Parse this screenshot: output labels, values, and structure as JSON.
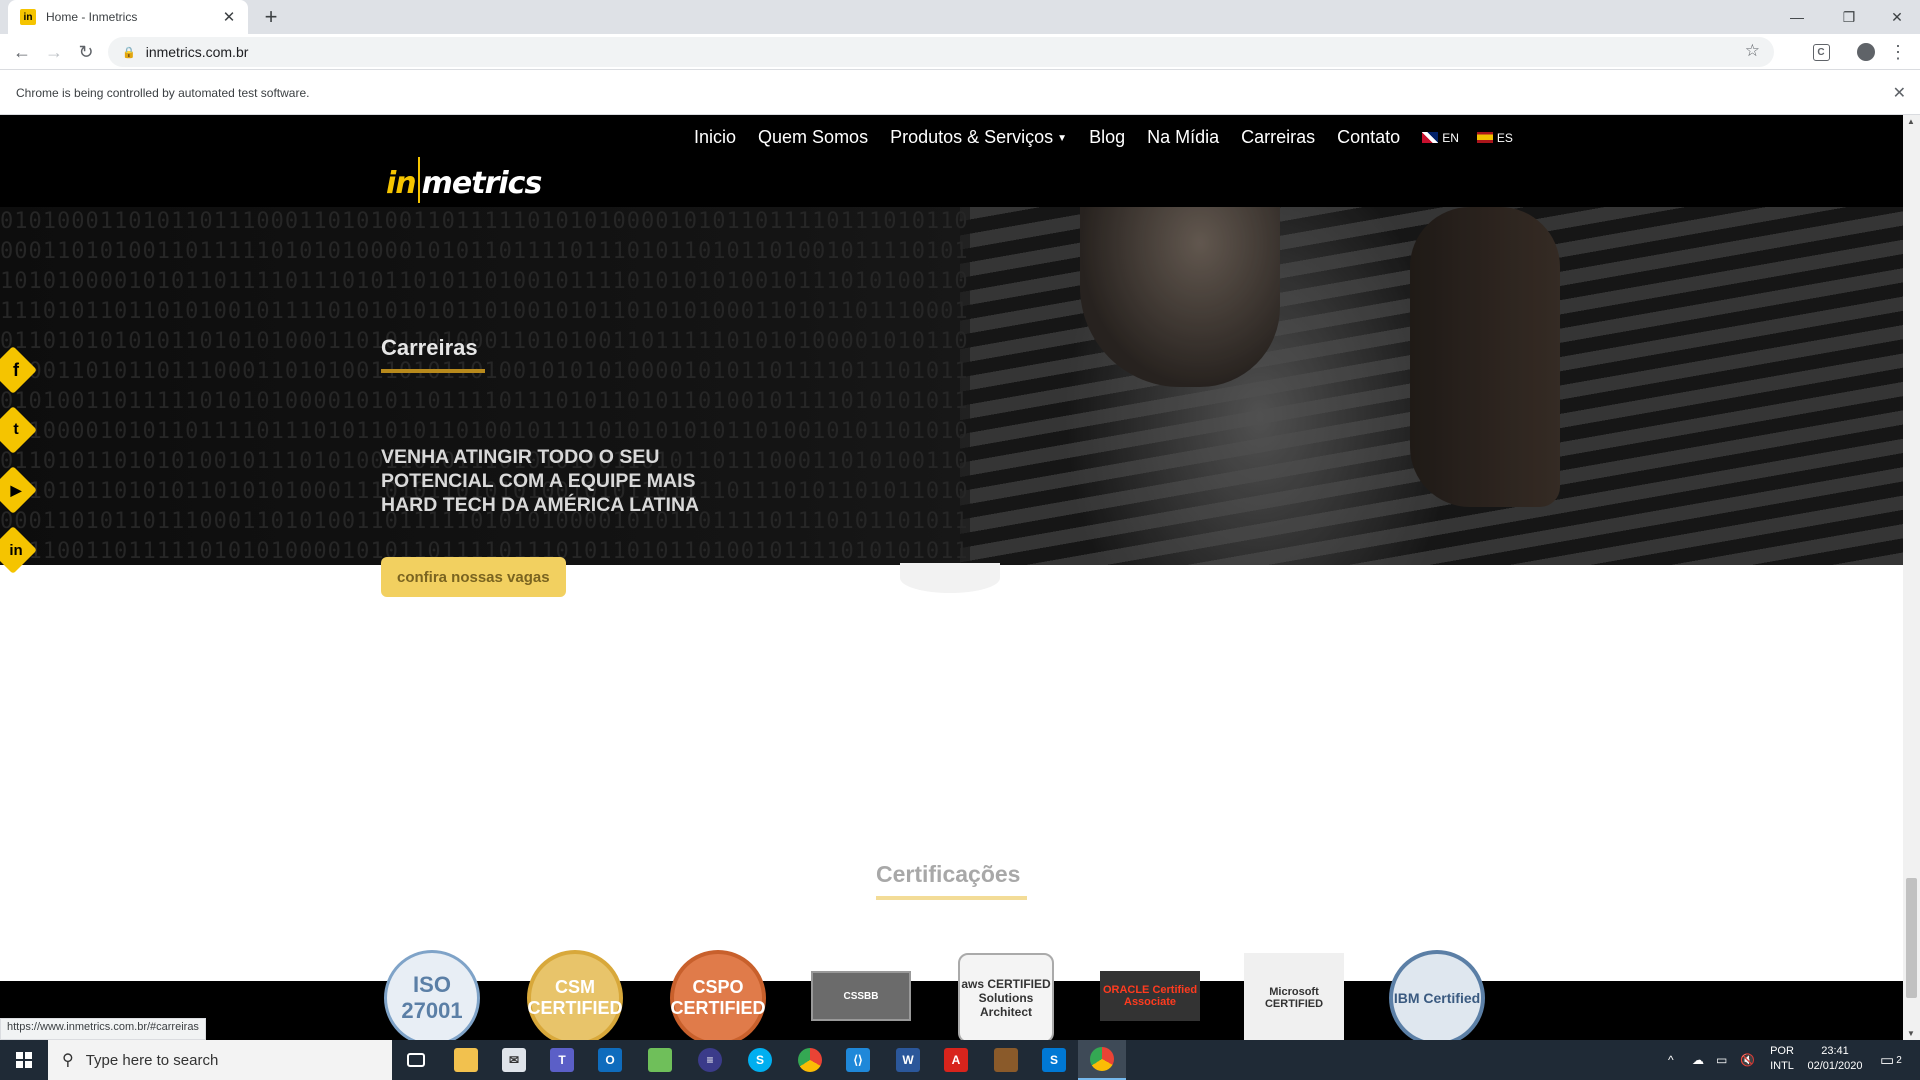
{
  "browser": {
    "tab_title": "Home - Inmetrics",
    "favicon_letter": "in",
    "url": "inmetrics.com.br",
    "infobar_message": "Chrome is being controlled by automated test software.",
    "ext_letter": "C"
  },
  "site": {
    "logo_in": "in",
    "logo_metrics": "metrics",
    "menu": [
      "Inicio",
      "Quem Somos",
      "Produtos & Serviços",
      "Blog",
      "Na Mídia",
      "Carreiras",
      "Contato"
    ],
    "lang_en": "EN",
    "lang_es": "ES",
    "hero": {
      "title": "Carreiras",
      "headline": "VENHA ATINGIR TODO O SEU POTENCIAL COM A EQUIPE MAIS HARD TECH DA AMÉRICA LATINA",
      "cta": "confira nossas vagas",
      "binary_rows": [
        "0101000110101101110001101010011011111010101000010101101111011101011010100",
        "0001101010011011111010101000010101101111011101011010110100101111010101010",
        "1010100001010110111101110101101011010010111101010101001011101010011010111",
        "1110101101101010010111101010101011010010101101010100011010110111000110101",
        "0110101010101101010100011010110100011010100110111110101010000101011011110",
        "1000110101101110001101010011010110100101010100001010110111101110101101010",
        "0101001101111101010100001010110111101110101101011010010111101010101101011",
        "1010000101011011110111010110101101001011110101010101101001010110101010001",
        "0110101101010100101110101001101011101010100110101101110001101010011011111",
        "0010101101010110101010001110101101010100101011011110111010110101101001011",
        "0001101011011100011010100110111110101010000101011011110111010110101101001",
        "1011001101111101010100001010110111101110101101011010010111101010101101011"
      ]
    },
    "social_icons": [
      "facebook-icon",
      "twitter-icon",
      "youtube-icon",
      "linkedin-icon"
    ],
    "social_glyphs": [
      "f",
      "t",
      "▶",
      "in"
    ],
    "certifications": {
      "title": "Certificações",
      "badges": [
        "ISO 27001",
        "CSM CERTIFIED",
        "CSPO CERTIFIED",
        "CSSBB",
        "aws CERTIFIED Solutions Architect",
        "ORACLE Certified Associate",
        "Microsoft CERTIFIED",
        "IBM Certified"
      ]
    },
    "status_url": "https://www.inmetrics.com.br/#carreiras"
  },
  "taskbar": {
    "search_placeholder": "Type here to search",
    "lang_line1": "POR",
    "lang_line2": "INTL",
    "time": "23:41",
    "date": "02/01/2020",
    "notification_count": "2",
    "apps": [
      "task-view-icon",
      "file-explorer-icon",
      "mail-icon",
      "teams-icon",
      "outlook-icon",
      "notepad-icon",
      "app-icon",
      "skype-icon",
      "chrome-icon",
      "vscode-icon",
      "word-icon",
      "acrobat-icon",
      "game-icon",
      "skype-business-icon",
      "chrome-active-icon"
    ]
  },
  "colors": {
    "brand_yellow": "#f5c400",
    "header_black": "#000000",
    "cta_yellow": "#f2d060",
    "taskbar": "#1f2a36"
  }
}
